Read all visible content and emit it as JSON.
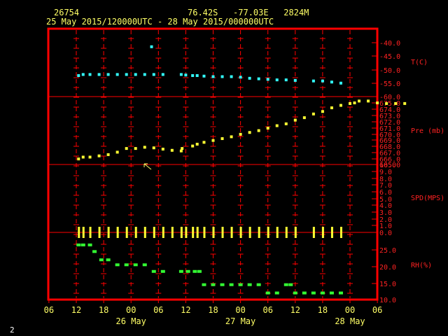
{
  "header": {
    "station_id": "26754",
    "location": "76.42S   -77.03E   2824M",
    "time_range": "25 May 2015/120000UTC - 28 May 2015/000000UTC"
  },
  "page_number": "2",
  "colors": {
    "frame": "#ff0000",
    "grid": "#ff0000",
    "temperature": "#33ffff",
    "pressure": "#ffff33",
    "wind_speed": "#ffff33",
    "rh": "#33ff33",
    "axis_text": "#ff2222",
    "time_text": "#ffff66",
    "cursor": "#ffff66"
  },
  "x_axis": {
    "hour_ticks": [
      "06",
      "12",
      "18",
      "00",
      "06",
      "12",
      "18",
      "00",
      "06",
      "12",
      "18",
      "00",
      "06"
    ],
    "hour_ticks_hours": [
      -6,
      0,
      6,
      12,
      18,
      24,
      30,
      36,
      42,
      48,
      54,
      60,
      66
    ],
    "day_labels": [
      {
        "label": "26 May",
        "hour": 12
      },
      {
        "label": "27 May",
        "hour": 36
      },
      {
        "label": "28 May",
        "hour": 60
      }
    ]
  },
  "chart_data": [
    {
      "type": "scatter",
      "ylabel": "T(C)",
      "ylim": [
        -60,
        -40
      ],
      "ticks": [
        "-40.0",
        "-45.0",
        "-50.0",
        "-55.0",
        "-60.0"
      ],
      "tick_values": [
        -40,
        -45,
        -50,
        -55,
        -60
      ],
      "x_unit": "hours since 25 May 2015 12UTC",
      "points": [
        [
          0.5,
          -52.2
        ],
        [
          1.5,
          -51.8
        ],
        [
          3,
          -51.8
        ],
        [
          5,
          -51.8
        ],
        [
          7,
          -51.8
        ],
        [
          9,
          -51.8
        ],
        [
          11,
          -51.8
        ],
        [
          13,
          -51.8
        ],
        [
          15,
          -51.8
        ],
        [
          17,
          -51.8
        ],
        [
          19,
          -51.8
        ],
        [
          16.5,
          -41.5
        ],
        [
          23,
          -51.8
        ],
        [
          24,
          -52.0
        ],
        [
          25.5,
          -52.2
        ],
        [
          26.5,
          -52.2
        ],
        [
          28,
          -52.4
        ],
        [
          30,
          -52.6
        ],
        [
          32,
          -52.6
        ],
        [
          34,
          -52.6
        ],
        [
          36,
          -52.8
        ],
        [
          38,
          -53.2
        ],
        [
          40,
          -53.4
        ],
        [
          42,
          -53.6
        ],
        [
          44,
          -53.8
        ],
        [
          46,
          -53.8
        ],
        [
          48,
          -54.0
        ],
        [
          52,
          -54.2
        ],
        [
          54,
          -54.2
        ],
        [
          56,
          -54.6
        ],
        [
          58,
          -55.0
        ]
      ]
    },
    {
      "type": "scatter",
      "ylabel": "Pre (mb)",
      "ylim": [
        664,
        676
      ],
      "ticks": [
        "675.0",
        "674.0",
        "673.0",
        "672.0",
        "671.0",
        "670.0",
        "669.0",
        "668.0",
        "667.0",
        "666.0",
        "665.0"
      ],
      "tick_values": [
        675,
        674,
        673,
        672,
        671,
        670,
        669,
        668,
        667,
        666,
        665
      ],
      "points": [
        [
          0.5,
          665.9
        ],
        [
          1.5,
          666.2
        ],
        [
          3,
          666.2
        ],
        [
          5,
          666.4
        ],
        [
          7,
          666.6
        ],
        [
          9,
          667.0
        ],
        [
          11,
          667.6
        ],
        [
          13,
          667.6
        ],
        [
          15,
          667.8
        ],
        [
          17,
          667.7
        ],
        [
          19,
          667.5
        ],
        [
          21,
          667.3
        ],
        [
          23,
          667.2
        ],
        [
          23.2,
          667.6
        ],
        [
          25.5,
          668.0
        ],
        [
          26.5,
          668.3
        ],
        [
          28,
          668.6
        ],
        [
          30,
          668.9
        ],
        [
          32,
          669.2
        ],
        [
          34,
          669.5
        ],
        [
          36,
          669.9
        ],
        [
          38,
          670.2
        ],
        [
          40,
          670.5
        ],
        [
          42,
          670.9
        ],
        [
          44,
          671.3
        ],
        [
          46,
          671.6
        ],
        [
          48,
          672.2
        ],
        [
          50,
          672.6
        ],
        [
          52,
          673.2
        ],
        [
          54,
          673.6
        ],
        [
          56,
          674.2
        ],
        [
          58,
          674.6
        ],
        [
          60,
          674.9
        ],
        [
          61,
          675.0
        ],
        [
          62,
          675.3
        ],
        [
          64,
          675.3
        ],
        [
          66,
          675.0
        ],
        [
          68,
          674.9
        ],
        [
          70,
          674.9
        ],
        [
          72,
          674.9
        ]
      ]
    },
    {
      "type": "scatter",
      "ylabel": "SPD(MPS)",
      "ylim": [
        0,
        10
      ],
      "ticks": [
        "10.0",
        "9.0",
        "8.0",
        "7.0",
        "6.0",
        "5.0",
        "4.0",
        "3.0",
        "2.0",
        "1.0",
        "0.0"
      ],
      "tick_values": [
        10,
        9,
        8,
        7,
        6,
        5,
        4,
        3,
        2,
        1,
        0
      ],
      "points": [
        [
          0.5,
          0
        ],
        [
          1.5,
          0
        ],
        [
          3,
          0
        ],
        [
          5,
          0
        ],
        [
          7,
          0
        ],
        [
          9,
          0
        ],
        [
          11,
          0
        ],
        [
          13,
          0
        ],
        [
          15,
          0
        ],
        [
          17,
          0
        ],
        [
          19,
          0
        ],
        [
          21,
          0
        ],
        [
          23,
          0
        ],
        [
          24,
          0
        ],
        [
          25.5,
          0
        ],
        [
          26.5,
          0
        ],
        [
          28,
          0
        ],
        [
          30,
          0
        ],
        [
          32,
          0
        ],
        [
          34,
          0
        ],
        [
          36,
          0
        ],
        [
          38,
          0
        ],
        [
          40,
          0
        ],
        [
          42,
          0
        ],
        [
          44,
          0
        ],
        [
          46,
          0
        ],
        [
          48,
          0
        ],
        [
          52,
          0
        ],
        [
          54,
          0
        ],
        [
          56,
          0
        ],
        [
          58,
          0
        ]
      ]
    },
    {
      "type": "scatter",
      "ylabel": "RH(%)",
      "ylim": [
        10,
        28
      ],
      "ticks": [
        "25.0",
        "20.0",
        "15.0",
        "10.0"
      ],
      "tick_values": [
        25,
        20,
        15,
        10
      ],
      "points": [
        [
          0.5,
          26.5
        ],
        [
          1.5,
          26.5
        ],
        [
          3,
          26.5
        ],
        [
          4,
          24.5
        ],
        [
          5.5,
          22.0
        ],
        [
          7,
          22.0
        ],
        [
          9,
          20.5
        ],
        [
          11,
          20.5
        ],
        [
          13,
          20.5
        ],
        [
          15,
          20.5
        ],
        [
          17,
          18.5
        ],
        [
          19,
          18.5
        ],
        [
          23,
          18.5
        ],
        [
          24.5,
          18.5
        ],
        [
          26,
          18.5
        ],
        [
          27,
          18.5
        ],
        [
          28,
          14.5
        ],
        [
          30,
          14.5
        ],
        [
          32,
          14.5
        ],
        [
          34,
          14.5
        ],
        [
          36,
          14.5
        ],
        [
          38,
          14.5
        ],
        [
          40,
          14.5
        ],
        [
          42,
          12.0
        ],
        [
          44,
          12.0
        ],
        [
          46,
          14.5
        ],
        [
          47,
          14.5
        ],
        [
          48,
          12.0
        ],
        [
          50,
          12.0
        ],
        [
          52,
          12.0
        ],
        [
          54,
          12.0
        ],
        [
          56,
          12.0
        ],
        [
          58,
          12.0
        ]
      ]
    }
  ]
}
